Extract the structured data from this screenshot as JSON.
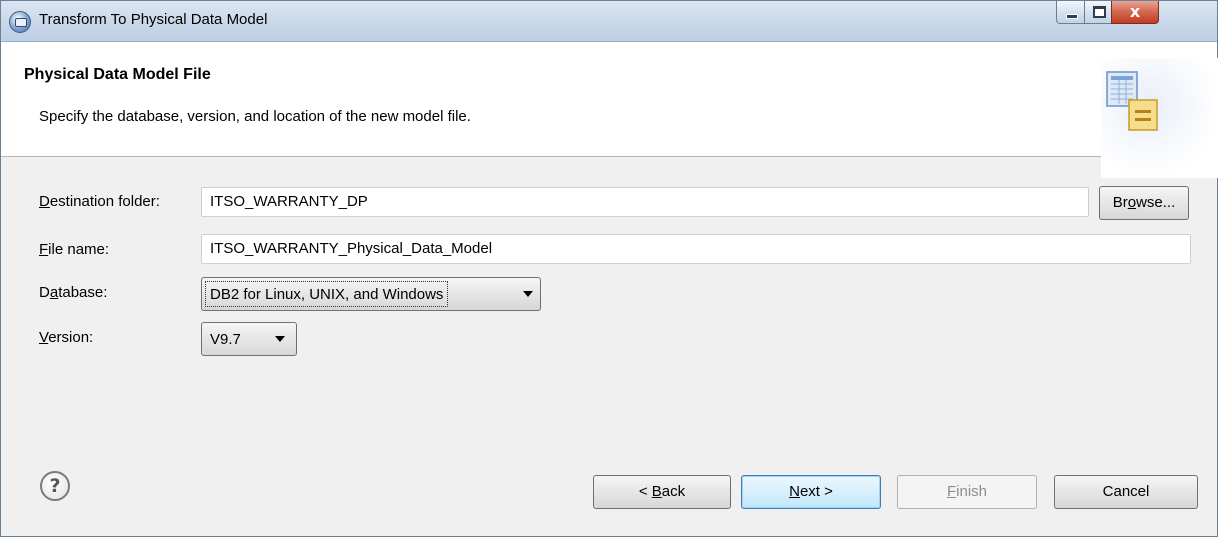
{
  "window": {
    "title": "Transform To Physical Data Model",
    "close_glyph": "x"
  },
  "banner": {
    "title": "Physical Data Model File",
    "description": "Specify the database, version, and location of the new model file.",
    "graphic": "data-model-wizard-graphic"
  },
  "form": {
    "destination_folder": {
      "label_pre": "",
      "label_mnemonic": "D",
      "label_post": "estination folder:",
      "value": "ITSO_WARRANTY_DP"
    },
    "browse_button": {
      "pre": "Br",
      "mnemonic": "o",
      "post": "wse..."
    },
    "file_name": {
      "label_pre": "",
      "label_mnemonic": "F",
      "label_post": "ile name:",
      "value": "ITSO_WARRANTY_Physical_Data_Model"
    },
    "database": {
      "label_pre": "D",
      "label_mnemonic": "a",
      "label_post": "tabase:",
      "selected": "DB2 for Linux, UNIX, and Windows"
    },
    "version": {
      "label_pre": "",
      "label_mnemonic": "V",
      "label_post": "ersion:",
      "selected": "V9.7"
    }
  },
  "footer": {
    "help_glyph": "?",
    "back": {
      "pre": "< ",
      "mnemonic": "B",
      "post": "ack"
    },
    "next": {
      "pre": "",
      "mnemonic": "N",
      "post": "ext >"
    },
    "finish": {
      "pre": "",
      "mnemonic": "F",
      "post": "inish"
    },
    "cancel": {
      "label": "Cancel"
    }
  },
  "colors": {
    "title_bar": "#c7d6e8",
    "close_button": "#c23d22",
    "default_button": "#bee6fd",
    "dialog_background": "#f0f0f0"
  }
}
